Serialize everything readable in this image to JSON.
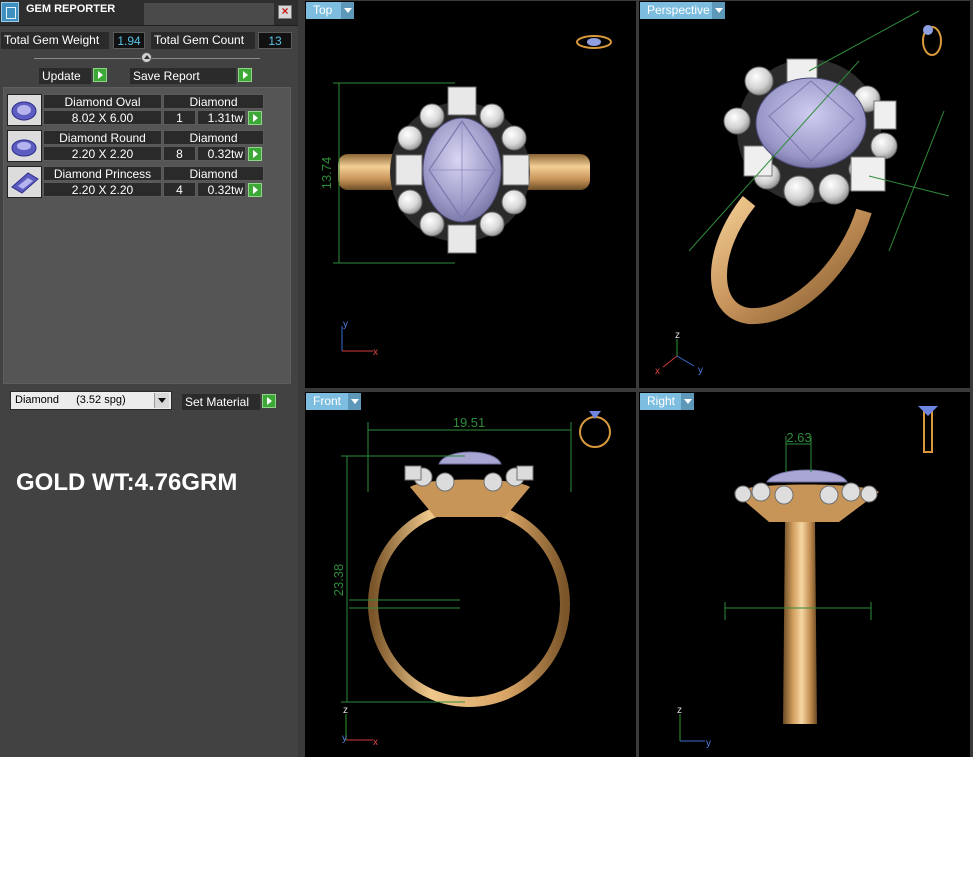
{
  "panel": {
    "title": "GEM REPORTER",
    "total_weight_label": "Total Gem Weight",
    "total_weight_value": "1.94",
    "total_count_label": "Total Gem Count",
    "total_count_value": "13",
    "update_label": "Update",
    "save_report_label": "Save Report",
    "gems": [
      {
        "name": "Diamond Oval",
        "size": "8.02 X 6.00",
        "material": "Diamond",
        "count": "1",
        "weight": "1.31tw",
        "shape_icon": "oval-gem-icon"
      },
      {
        "name": "Diamond Round",
        "size": "2.20 X 2.20",
        "material": "Diamond",
        "count": "8",
        "weight": "0.32tw",
        "shape_icon": "round-gem-icon"
      },
      {
        "name": "Diamond Princess",
        "size": "2.20 X 2.20",
        "material": "Diamond",
        "count": "4",
        "weight": "0.32tw",
        "shape_icon": "princess-gem-icon"
      }
    ],
    "material_select": {
      "value": "Diamond",
      "spg": "(3.52 spg)"
    },
    "set_material_label": "Set Material",
    "gold_weight_text": "GOLD WT:4.76GRM"
  },
  "viewports": {
    "top": {
      "label": "Top",
      "dimension": "13.74"
    },
    "perspective": {
      "label": "Perspective"
    },
    "front": {
      "label": "Front",
      "width_dimension": "19.51",
      "height_dimension": "23.38"
    },
    "right": {
      "label": "Right",
      "dimension": "2.63"
    }
  },
  "axes": {
    "x": "x",
    "y": "y",
    "z": "z"
  },
  "colors": {
    "panel_bg": "#424242",
    "tab_blue": "#7dbee0",
    "value_cyan": "#59c3e6",
    "gold": "#d9a96a",
    "gem_lavender": "#a7a4cf",
    "dimension_green": "#2e8a3a",
    "go_green": "#3da836"
  }
}
